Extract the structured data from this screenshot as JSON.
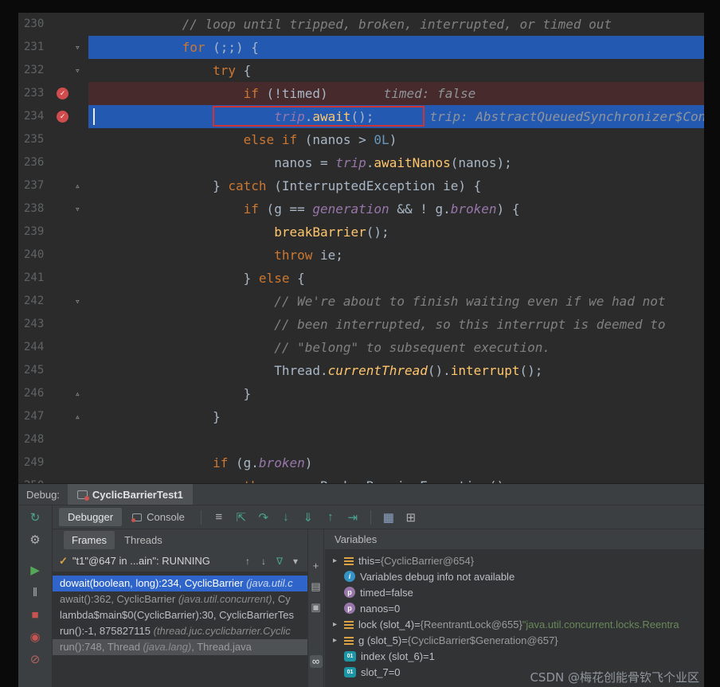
{
  "watermark": "CSDN @梅花创能骨钦飞个业区",
  "editor": {
    "lines": [
      {
        "num": "230",
        "indent": 12,
        "segs": [
          [
            "cmt",
            "// loop until tripped, broken, interrupted, or timed out"
          ]
        ]
      },
      {
        "num": "231",
        "indent": 12,
        "row": "exec",
        "fold": "v",
        "segs": [
          [
            "kw",
            "for"
          ],
          [
            "pl",
            " (;;) {"
          ]
        ]
      },
      {
        "num": "232",
        "indent": 16,
        "fold": "v",
        "segs": [
          [
            "kw",
            "try"
          ],
          [
            "pl",
            " {"
          ]
        ]
      },
      {
        "num": "233",
        "indent": 20,
        "row": "bpline",
        "bp": true,
        "segs": [
          [
            "kw",
            "if"
          ],
          [
            "pl",
            " (!timed)"
          ]
        ],
        "hint": "timed: false"
      },
      {
        "num": "234",
        "indent": 24,
        "row": "exec",
        "bp": true,
        "caret": true,
        "box": true,
        "segs": [
          [
            "fld",
            "trip"
          ],
          [
            "pl",
            "."
          ],
          [
            "mth",
            "await"
          ],
          [
            "pl",
            "();"
          ]
        ],
        "hint": "trip: AbstractQueuedSynchronizer$Con"
      },
      {
        "num": "235",
        "indent": 20,
        "segs": [
          [
            "kw",
            "else"
          ],
          [
            "pl",
            " "
          ],
          [
            "kw",
            "if"
          ],
          [
            "pl",
            " (nanos > "
          ],
          [
            "num",
            "0L"
          ],
          [
            "pl",
            ")"
          ]
        ]
      },
      {
        "num": "236",
        "indent": 24,
        "segs": [
          [
            "pl",
            "nanos = "
          ],
          [
            "fld",
            "trip"
          ],
          [
            "pl",
            "."
          ],
          [
            "mth",
            "awaitNanos"
          ],
          [
            "pl",
            "(nanos);"
          ]
        ]
      },
      {
        "num": "237",
        "indent": 16,
        "fold": "^",
        "segs": [
          [
            "pl",
            "} "
          ],
          [
            "kw",
            "catch"
          ],
          [
            "pl",
            " (InterruptedException ie) {"
          ]
        ]
      },
      {
        "num": "238",
        "indent": 20,
        "fold": "v",
        "segs": [
          [
            "kw",
            "if"
          ],
          [
            "pl",
            " (g == "
          ],
          [
            "fld",
            "generation"
          ],
          [
            "pl",
            " && ! g."
          ],
          [
            "fld",
            "broken"
          ],
          [
            "pl",
            ") {"
          ]
        ]
      },
      {
        "num": "239",
        "indent": 24,
        "segs": [
          [
            "mth",
            "breakBarrier"
          ],
          [
            "pl",
            "();"
          ]
        ]
      },
      {
        "num": "240",
        "indent": 24,
        "segs": [
          [
            "kw",
            "throw"
          ],
          [
            "pl",
            " ie;"
          ]
        ]
      },
      {
        "num": "241",
        "indent": 20,
        "segs": [
          [
            "pl",
            "} "
          ],
          [
            "kw",
            "else"
          ],
          [
            "pl",
            " {"
          ]
        ]
      },
      {
        "num": "242",
        "indent": 24,
        "fold": "v",
        "segs": [
          [
            "cmt",
            "// We're about to finish waiting even if we had not"
          ]
        ]
      },
      {
        "num": "243",
        "indent": 24,
        "segs": [
          [
            "cmt",
            "// been interrupted, so this interrupt is deemed to"
          ]
        ]
      },
      {
        "num": "244",
        "indent": 24,
        "segs": [
          [
            "cmt",
            "// \"belong\" to subsequent execution."
          ]
        ]
      },
      {
        "num": "245",
        "indent": 24,
        "segs": [
          [
            "pl",
            "Thread."
          ],
          [
            "mths",
            "currentThread"
          ],
          [
            "pl",
            "()."
          ],
          [
            "mth",
            "interrupt"
          ],
          [
            "pl",
            "();"
          ]
        ]
      },
      {
        "num": "246",
        "indent": 20,
        "fold": "^",
        "segs": [
          [
            "pl",
            "}"
          ]
        ]
      },
      {
        "num": "247",
        "indent": 16,
        "fold": "^",
        "segs": [
          [
            "pl",
            "}"
          ]
        ]
      },
      {
        "num": "248",
        "indent": 0,
        "segs": []
      },
      {
        "num": "249",
        "indent": 16,
        "segs": [
          [
            "kw",
            "if"
          ],
          [
            "pl",
            " (g."
          ],
          [
            "fld",
            "broken"
          ],
          [
            "pl",
            ")"
          ]
        ]
      },
      {
        "num": "250",
        "indent": 20,
        "segs": [
          [
            "kw",
            "throw"
          ],
          [
            "pl",
            " "
          ],
          [
            "kw",
            "new"
          ],
          [
            "pl",
            " BrokenBarrierException();"
          ]
        ]
      }
    ]
  },
  "debug": {
    "header": {
      "label": "Debug:",
      "tab": "CyclicBarrierTest1"
    },
    "left_strip": [
      {
        "name": "rerun-icon",
        "glyph": "↻",
        "cls": "teal"
      },
      {
        "name": "wrench-icon",
        "glyph": "⚙",
        "cls": "gray"
      },
      {
        "name": "resume-icon",
        "glyph": "▶",
        "cls": "green",
        "gap_before": true
      },
      {
        "name": "pause-icon",
        "glyph": "‖",
        "cls": "gray"
      },
      {
        "name": "stop-icon",
        "glyph": "■",
        "cls": "red"
      },
      {
        "name": "view-breakpoints-icon",
        "glyph": "◉",
        "cls": "red"
      },
      {
        "name": "mute-breakpoints-icon",
        "glyph": "⊘",
        "cls": "redmuted"
      }
    ],
    "toolbar": {
      "tabs": [
        {
          "label": "Debugger",
          "selected": true
        },
        {
          "label": "Console",
          "selected": false
        }
      ],
      "icons": [
        {
          "name": "restore-layout-icon",
          "glyph": "≡",
          "cls": "gray"
        },
        {
          "name": "show-execution-point-icon",
          "glyph": "⇱",
          "cls": "teal"
        },
        {
          "name": "step-over-icon",
          "glyph": "↷",
          "cls": "teal"
        },
        {
          "name": "step-into-icon",
          "glyph": "↓",
          "cls": "teal"
        },
        {
          "name": "force-step-into-icon",
          "glyph": "⇓",
          "cls": "teal"
        },
        {
          "name": "step-out-icon",
          "glyph": "↑",
          "cls": "teal"
        },
        {
          "name": "run-to-cursor-icon",
          "glyph": "⇥",
          "cls": "teal",
          "sep_after": true
        },
        {
          "name": "thread-dump-icon",
          "glyph": "▦",
          "cls": "blue"
        },
        {
          "name": "layout-settings-icon",
          "glyph": "⊞",
          "cls": "gray"
        }
      ]
    },
    "frames": {
      "tabs": [
        "Frames",
        "Threads"
      ],
      "thread": {
        "check": "✓",
        "label": "\"t1\"@647 in ...ain\": RUNNING"
      },
      "thread_icons": [
        {
          "name": "frame-up-icon",
          "glyph": "↑",
          "cls": "gray"
        },
        {
          "name": "frame-down-icon",
          "glyph": "↓",
          "cls": "gray"
        },
        {
          "name": "filter-frames-icon",
          "glyph": "∇",
          "cls": "teal"
        },
        {
          "name": "thread-dropdown-icon",
          "glyph": "▾",
          "cls": "gray"
        }
      ],
      "rows": [
        {
          "cls": "selected",
          "segs": [
            [
              "fname",
              "dowait(boolean, long):234, CyclicBarrier "
            ],
            [
              "floc",
              "(java.util.c"
            ]
          ]
        },
        {
          "cls": "library",
          "segs": [
            [
              "fname",
              "await():362, CyclicBarrier "
            ],
            [
              "floc",
              "(java.util.concurrent)"
            ],
            [
              "fname",
              ", Cy"
            ]
          ]
        },
        {
          "cls": "",
          "segs": [
            [
              "fname",
              "lambda$main$0(CyclicBarrier):30, CyclicBarrierTes"
            ]
          ]
        },
        {
          "cls": "",
          "segs": [
            [
              "fname",
              "run():-1, 875827115 "
            ],
            [
              "floc",
              "(thread.juc.cyclicbarrier.Cyclic"
            ]
          ]
        },
        {
          "cls": "hiddenf",
          "segs": [
            [
              "fname",
              "run():748, Thread "
            ],
            [
              "floc",
              "(java.lang)"
            ],
            [
              "fname",
              ", Thread.java"
            ]
          ]
        }
      ]
    },
    "mid_icons": [
      {
        "name": "add-watch-icon",
        "glyph": "+"
      },
      {
        "name": "watch-list-icon",
        "glyph": "▤"
      },
      {
        "name": "copy-value-icon",
        "glyph": "▣"
      },
      {
        "name": "evaluate-infinity-icon",
        "glyph": "∞",
        "boxed": true
      }
    ],
    "variables": {
      "header": "Variables",
      "rows": [
        {
          "chev": true,
          "icon": "obj",
          "segs": [
            [
              "vname",
              "this"
            ],
            [
              "veq",
              " = "
            ],
            [
              "vref",
              "{CyclicBarrier@654}"
            ]
          ]
        },
        {
          "icon": "info",
          "segs": [
            [
              "vplain",
              "Variables debug info not available"
            ]
          ]
        },
        {
          "icon": "param",
          "segs": [
            [
              "vname",
              "timed"
            ],
            [
              "veq",
              " = "
            ],
            [
              "vval",
              "false"
            ]
          ]
        },
        {
          "icon": "param",
          "segs": [
            [
              "vname",
              "nanos"
            ],
            [
              "veq",
              " = "
            ],
            [
              "vval",
              "0"
            ]
          ]
        },
        {
          "chev": true,
          "icon": "obj",
          "segs": [
            [
              "vname",
              "lock (slot_4)"
            ],
            [
              "veq",
              " = "
            ],
            [
              "vref",
              "{ReentrantLock@655} "
            ],
            [
              "vstr",
              "\"java.util.concurrent.locks.Reentra"
            ]
          ]
        },
        {
          "chev": true,
          "icon": "obj",
          "segs": [
            [
              "vname",
              "g (slot_5)"
            ],
            [
              "veq",
              " = "
            ],
            [
              "vref",
              "{CyclicBarrier$Generation@657}"
            ]
          ]
        },
        {
          "icon": "prim",
          "segs": [
            [
              "vname",
              "index (slot_6)"
            ],
            [
              "veq",
              " = "
            ],
            [
              "vval",
              "1"
            ]
          ]
        },
        {
          "icon": "prim",
          "segs": [
            [
              "vname",
              "slot_7"
            ],
            [
              "veq",
              " = "
            ],
            [
              "vval",
              "0"
            ]
          ]
        }
      ]
    }
  }
}
